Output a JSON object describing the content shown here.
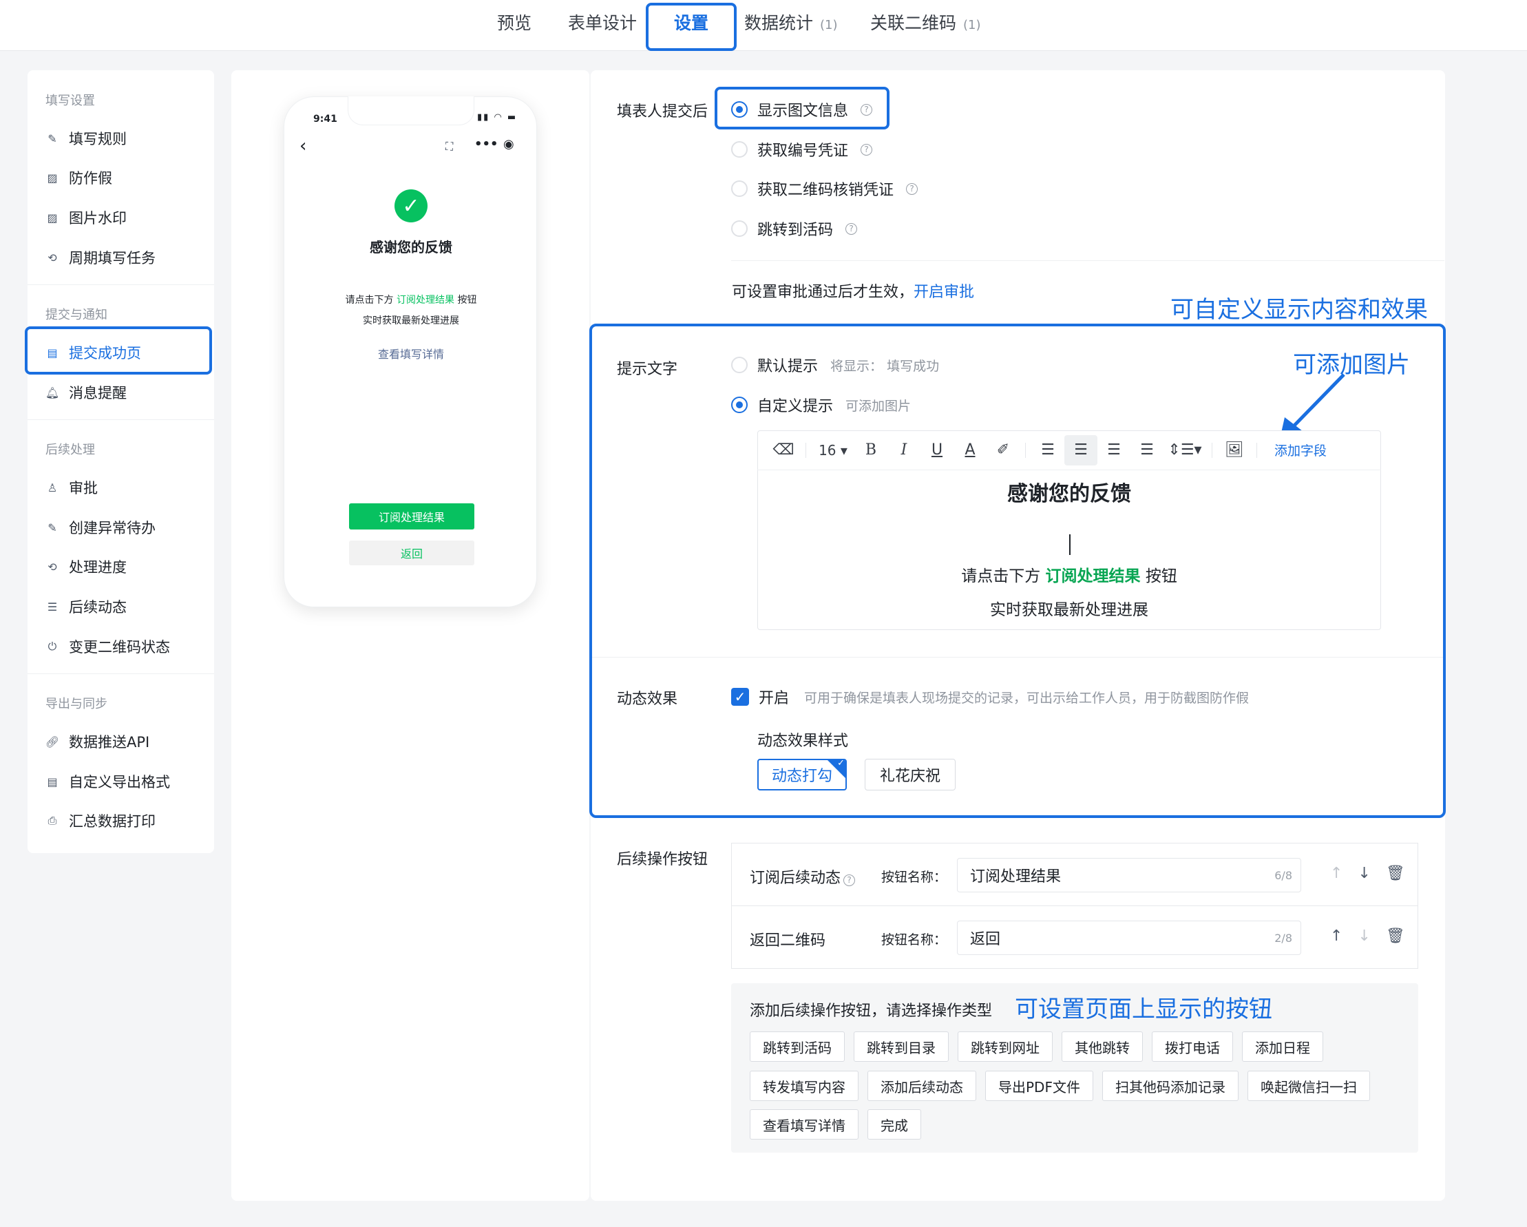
{
  "tabs": [
    {
      "label": "预览",
      "count": ""
    },
    {
      "label": "表单设计",
      "count": ""
    },
    {
      "label": "设置",
      "count": ""
    },
    {
      "label": "数据统计",
      "count": "(1)"
    },
    {
      "label": "关联二维码",
      "count": "(1)"
    }
  ],
  "sidebar": {
    "sections": [
      {
        "title": "填写设置",
        "items": [
          "填写规则",
          "防作假",
          "图片水印",
          "周期填写任务"
        ]
      },
      {
        "title": "提交与通知",
        "items": [
          "提交成功页",
          "消息提醒"
        ]
      },
      {
        "title": "后续处理",
        "items": [
          "审批",
          "创建异常待办",
          "处理进度",
          "后续动态",
          "变更二维码状态"
        ]
      },
      {
        "title": "导出与同步",
        "items": [
          "数据推送API",
          "自定义导出格式",
          "汇总数据打印"
        ]
      }
    ],
    "active_item": "提交成功页"
  },
  "phone": {
    "time": "9:41",
    "title": "感谢您的反馈",
    "line1_pre": "请点击下方",
    "line1_link": "订阅处理结果",
    "line1_post": "按钮",
    "line2": "实时获取最新处理进展",
    "detail_link": "查看填写详情",
    "primary_button": "订阅处理结果",
    "secondary_button": "返回"
  },
  "after_submit": {
    "label": "填表人提交后",
    "options": [
      "显示图文信息",
      "获取编号凭证",
      "获取二维码核销凭证",
      "跳转到活码"
    ],
    "selected": "显示图文信息",
    "approval_note": "可设置审批通过后才生效，",
    "approval_link": "开启审批"
  },
  "annotations": {
    "custom_display": "可自定义显示内容和效果",
    "add_image": "可添加图片",
    "buttons_note": "可设置页面上显示的按钮"
  },
  "hint_text": {
    "label": "提示文字",
    "default_option": "默认提示",
    "default_preview_label": "将显示：",
    "default_preview_value": "填写成功",
    "custom_option": "自定义提示",
    "custom_hint": "可添加图片",
    "font_size": "16",
    "add_field": "添加字段",
    "editor_title": "感谢您的反馈",
    "editor_line1_pre": "请点击下方",
    "editor_line1_link": "订阅处理结果",
    "editor_line1_post": "按钮",
    "editor_line2": "实时获取最新处理进展"
  },
  "animation": {
    "label": "动态效果",
    "enable_label": "开启",
    "enable_desc": "可用于确保是填表人现场提交的记录，可出示给工作人员，用于防截图防作假",
    "style_label": "动态效果样式",
    "styles": [
      "动态打勾",
      "礼花庆祝"
    ],
    "selected_style": "动态打勾"
  },
  "follow_buttons": {
    "label": "后续操作按钮",
    "name_label": "按钮名称：",
    "rows": [
      {
        "type": "订阅后续动态",
        "value": "订阅处理结果",
        "count": "6/8"
      },
      {
        "type": "返回二维码",
        "value": "返回",
        "count": "2/8"
      }
    ],
    "add_title": "添加后续操作按钮，请选择操作类型",
    "choices": [
      [
        "跳转到活码",
        "跳转到目录",
        "跳转到网址",
        "其他跳转",
        "拨打电话",
        "添加日程"
      ],
      [
        "转发填写内容",
        "添加后续动态",
        "导出PDF文件",
        "扫其他码添加记录",
        "唤起微信扫一扫"
      ],
      [
        "查看填写详情",
        "完成"
      ]
    ]
  },
  "colors": {
    "accent": "#1a6fe0",
    "green": "#07c160",
    "highlight": "#1a6fe0"
  }
}
